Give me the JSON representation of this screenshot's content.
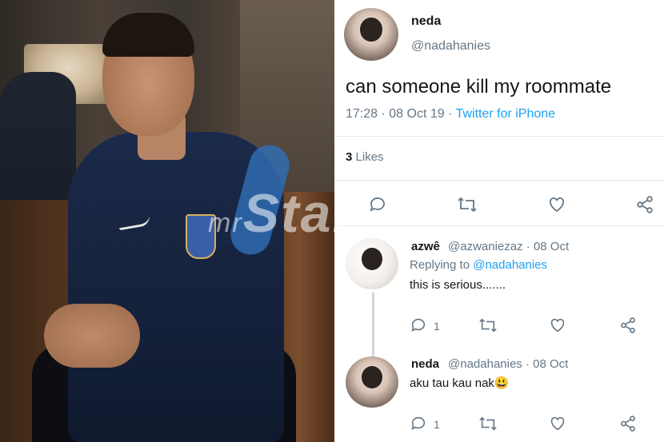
{
  "photo": {
    "description_icon": "person-photo"
  },
  "watermark": {
    "prefix": "mr",
    "brand": "Star"
  },
  "tweet": {
    "author_name": "neda",
    "author_handle": "@nadahanies",
    "text": "can someone kill my roommate",
    "time": "17:28 · 08 Oct 19 · ",
    "source": "Twitter for iPhone",
    "likes_count": "3",
    "likes_label": "Likes",
    "actions": [
      "comment-icon",
      "retweet-icon",
      "heart-icon",
      "share-icon"
    ]
  },
  "replies": [
    {
      "name": "azwê",
      "handle": "@azwaniezaz",
      "date": "· 08 Oct",
      "replying_prefix": "Replying to ",
      "replying_to": "@nadahanies",
      "text": "this is serious.......",
      "reply_count": "1"
    },
    {
      "name": "neda",
      "handle": "@nadahanies",
      "date": "· 08 Oct",
      "text": "aku tau kau nak😃",
      "reply_count": "1"
    }
  ],
  "colors": {
    "link": "#1da1f2",
    "muted": "#657786",
    "text": "#14171a"
  }
}
